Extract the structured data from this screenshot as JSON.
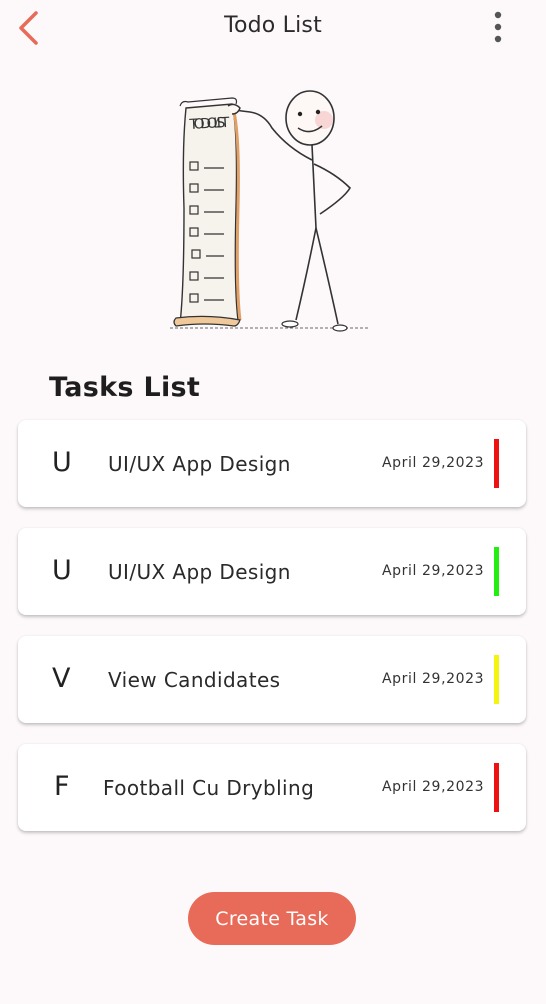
{
  "appbar": {
    "title": "Todo List",
    "back_icon": "chevron-left-icon",
    "more_icon": "more-vertical-icon",
    "accent_color": "#e86a58"
  },
  "illustration": {
    "icon": "todo-list-stickman-illustration",
    "scroll_title": "TODO LIST"
  },
  "section": {
    "title": "Tasks List"
  },
  "tasks": [
    {
      "initial": "U",
      "name": "UI/UX App Design",
      "date": "April 29,2023",
      "priority_color": "#ee1111"
    },
    {
      "initial": "U",
      "name": "UI/UX App Design",
      "date": "April 29,2023",
      "priority_color": "#22ee11"
    },
    {
      "initial": "V",
      "name": "View Candidates",
      "date": "April 29,2023",
      "priority_color": "#f4f411"
    },
    {
      "initial": "F",
      "name": "Football Cu Drybling",
      "date": "April 29,2023",
      "priority_color": "#ee1111"
    }
  ],
  "actions": {
    "create_label": "Create Task",
    "create_color": "#e86a58"
  }
}
